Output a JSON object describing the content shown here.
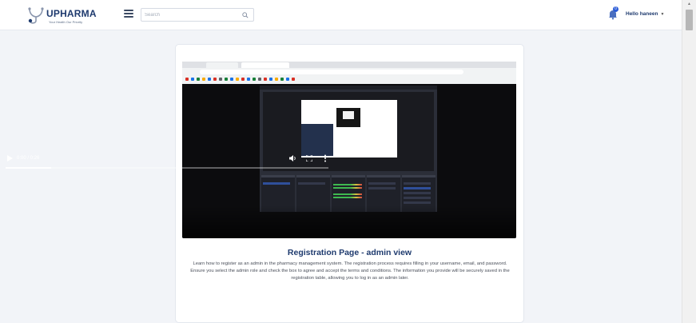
{
  "header": {
    "logo_text": "UPHARMA",
    "logo_tagline": "Your Health Our Priority",
    "menu_icon": "hamburger-icon",
    "search_placeholder": "Search",
    "notification_count": "0",
    "user_greeting": "Hello haneen"
  },
  "video": {
    "current_time": "0:00 / 0:26",
    "progress": 0.14,
    "title": "Registration Page - admin view",
    "description": "Learn how to register as an admin in the pharmacy management system. The registration process requires filling in your username, email, and password. Ensure you select the admin role and check the box to agree and accept the terms and conditions. The information you provide will be securely saved in the registration table, allowing you to log in as an admin later."
  },
  "colors": {
    "brand": "#1e3a6e",
    "accent": "#2a5bd7",
    "page_bg": "#f2f4f8"
  }
}
